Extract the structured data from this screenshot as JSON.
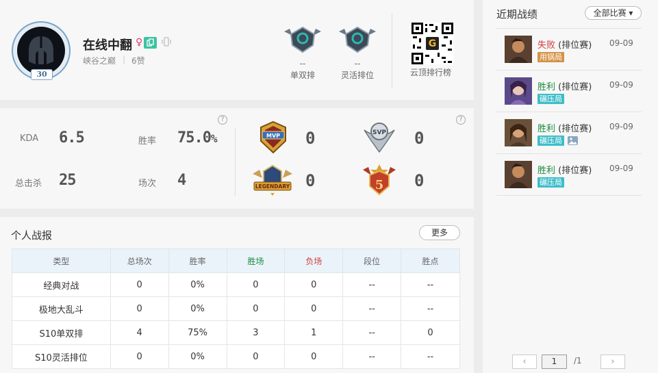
{
  "profile": {
    "name": "在线中翻",
    "gender_symbol": "♀",
    "level": "30",
    "region": "峡谷之巅",
    "separator": "|",
    "likes": "6赞",
    "ranks": [
      {
        "value": "--",
        "name": "单双排"
      },
      {
        "value": "--",
        "name": "灵活排位"
      }
    ],
    "qr_label": "云顶排行榜"
  },
  "stats": {
    "kda_label": "KDA",
    "kda_value": "6.5",
    "winrate_label": "胜率",
    "winrate_value": "75.0",
    "winrate_unit": "%",
    "kills_label": "总击杀",
    "kills_value": "25",
    "games_label": "场次",
    "games_value": "4",
    "help_symbol": "?",
    "badges": [
      {
        "icon": "mvp-badge-icon",
        "count": "0"
      },
      {
        "icon": "svp-badge-icon",
        "count": "0"
      },
      {
        "icon": "legendary-badge-icon",
        "count": "0"
      },
      {
        "icon": "pentakill-badge-icon",
        "count": "0"
      }
    ]
  },
  "report": {
    "title": "个人战报",
    "more_label": "更多",
    "headers": [
      "类型",
      "总场次",
      "胜率",
      "胜场",
      "负场",
      "段位",
      "胜点"
    ],
    "rows": [
      [
        "经典对战",
        "0",
        "0%",
        "0",
        "0",
        "--",
        "--"
      ],
      [
        "极地大乱斗",
        "0",
        "0%",
        "0",
        "0",
        "--",
        "--"
      ],
      [
        "S10单双排",
        "4",
        "75%",
        "3",
        "1",
        "--",
        "0"
      ],
      [
        "S10灵活排位",
        "0",
        "0%",
        "0",
        "0",
        "--",
        "--"
      ]
    ]
  },
  "recent": {
    "title": "近期战绩",
    "filter_label": "全部比赛 ▾",
    "matches": [
      {
        "result": "失败",
        "mode": " (排位赛)",
        "date": "09-09",
        "tag": "用锅局",
        "tag_color": "#d49347",
        "result_color": "#d23c3c"
      },
      {
        "result": "胜利",
        "mode": " (排位赛)",
        "date": "09-09",
        "tag": "碾压局",
        "tag_color": "#3dbdc8",
        "result_color": "#1b8a3f"
      },
      {
        "result": "胜利",
        "mode": " (排位赛)",
        "date": "09-09",
        "tag": "碾压局",
        "tag_color": "#3dbdc8",
        "result_color": "#1b8a3f"
      },
      {
        "result": "胜利",
        "mode": " (排位赛)",
        "date": "09-09",
        "tag": "碾压局",
        "tag_color": "#3dbdc8",
        "result_color": "#1b8a3f"
      }
    ],
    "pager": {
      "prev": "‹",
      "current": "1",
      "total": "/1",
      "next": "›"
    }
  }
}
